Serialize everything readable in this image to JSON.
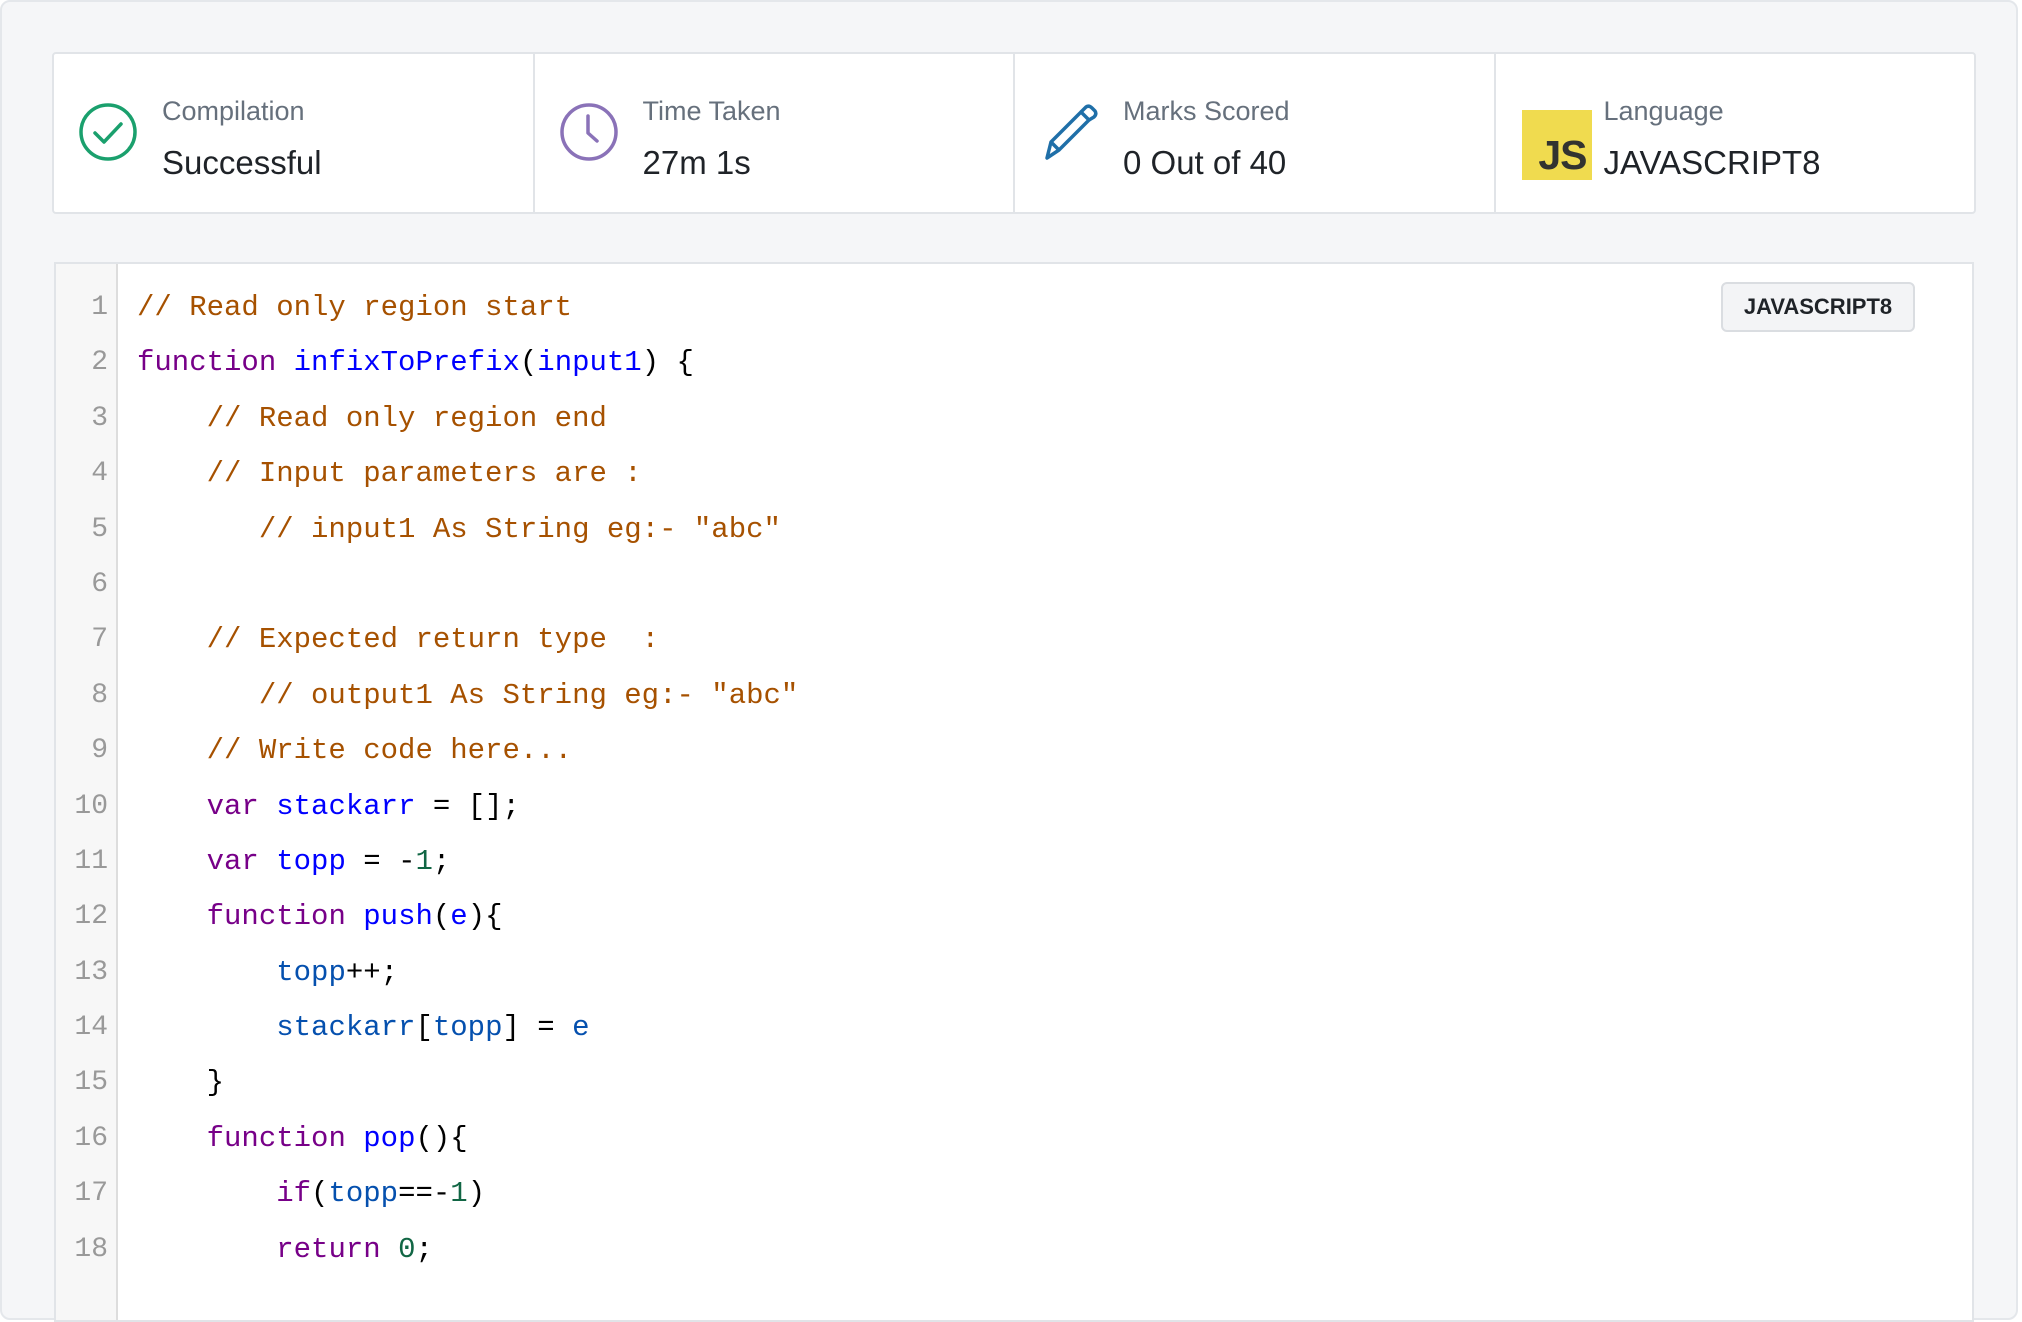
{
  "stats": [
    {
      "label": "Compilation",
      "value": "Successful",
      "icon": "check-circle-icon",
      "color": "#1aa06d"
    },
    {
      "label": "Time Taken",
      "value": "27m 1s",
      "icon": "clock-icon",
      "color": "#8a72b8"
    },
    {
      "label": "Marks Scored",
      "value": "0 Out of 40",
      "icon": "pencil-icon",
      "color": "#1f6fa8"
    },
    {
      "label": "Language",
      "value": "JAVASCRIPT8",
      "icon": "js-logo-icon",
      "logo_text": "JS",
      "color": "#f0db4f"
    }
  ],
  "editor": {
    "language_badge": "JAVASCRIPT8",
    "lines": [
      {
        "n": "1",
        "tokens": [
          {
            "t": "// Read only region start",
            "c": "comment"
          }
        ]
      },
      {
        "n": "2",
        "tokens": [
          {
            "t": "function ",
            "c": "keyword"
          },
          {
            "t": "infixToPrefix",
            "c": "def"
          },
          {
            "t": "(",
            "c": "plain"
          },
          {
            "t": "input1",
            "c": "def"
          },
          {
            "t": ") {",
            "c": "plain"
          }
        ]
      },
      {
        "n": "3",
        "tokens": [
          {
            "t": "    // Read only region end",
            "c": "comment"
          }
        ]
      },
      {
        "n": "4",
        "tokens": [
          {
            "t": "    // Input parameters are :",
            "c": "comment"
          }
        ]
      },
      {
        "n": "5",
        "tokens": [
          {
            "t": "       // input1 As String eg:- \"abc\"",
            "c": "comment"
          }
        ]
      },
      {
        "n": "6",
        "tokens": []
      },
      {
        "n": "7",
        "tokens": [
          {
            "t": "    // Expected return type  :",
            "c": "comment"
          }
        ]
      },
      {
        "n": "8",
        "tokens": [
          {
            "t": "       // output1 As String eg:- \"abc\"",
            "c": "comment"
          }
        ]
      },
      {
        "n": "9",
        "tokens": [
          {
            "t": "    // Write code here...",
            "c": "comment"
          }
        ]
      },
      {
        "n": "10",
        "tokens": [
          {
            "t": "    ",
            "c": "plain"
          },
          {
            "t": "var ",
            "c": "keyword"
          },
          {
            "t": "stackarr",
            "c": "def"
          },
          {
            "t": " = [];",
            "c": "plain"
          }
        ]
      },
      {
        "n": "11",
        "tokens": [
          {
            "t": "    ",
            "c": "plain"
          },
          {
            "t": "var ",
            "c": "keyword"
          },
          {
            "t": "topp",
            "c": "def"
          },
          {
            "t": " = -",
            "c": "plain"
          },
          {
            "t": "1",
            "c": "number"
          },
          {
            "t": ";",
            "c": "plain"
          }
        ]
      },
      {
        "n": "12",
        "tokens": [
          {
            "t": "    ",
            "c": "plain"
          },
          {
            "t": "function ",
            "c": "keyword"
          },
          {
            "t": "push",
            "c": "def"
          },
          {
            "t": "(",
            "c": "plain"
          },
          {
            "t": "e",
            "c": "def"
          },
          {
            "t": "){",
            "c": "plain"
          }
        ]
      },
      {
        "n": "13",
        "tokens": [
          {
            "t": "        ",
            "c": "plain"
          },
          {
            "t": "topp",
            "c": "variable"
          },
          {
            "t": "++;",
            "c": "plain"
          }
        ]
      },
      {
        "n": "14",
        "tokens": [
          {
            "t": "        ",
            "c": "plain"
          },
          {
            "t": "stackarr",
            "c": "variable"
          },
          {
            "t": "[",
            "c": "plain"
          },
          {
            "t": "topp",
            "c": "variable"
          },
          {
            "t": "] = ",
            "c": "plain"
          },
          {
            "t": "e",
            "c": "variable"
          }
        ]
      },
      {
        "n": "15",
        "tokens": [
          {
            "t": "    }",
            "c": "plain"
          }
        ]
      },
      {
        "n": "16",
        "tokens": [
          {
            "t": "    ",
            "c": "plain"
          },
          {
            "t": "function ",
            "c": "keyword"
          },
          {
            "t": "pop",
            "c": "def"
          },
          {
            "t": "(){",
            "c": "plain"
          }
        ]
      },
      {
        "n": "17",
        "tokens": [
          {
            "t": "        ",
            "c": "plain"
          },
          {
            "t": "if",
            "c": "keyword"
          },
          {
            "t": "(",
            "c": "plain"
          },
          {
            "t": "topp",
            "c": "variable"
          },
          {
            "t": "==-",
            "c": "plain"
          },
          {
            "t": "1",
            "c": "number"
          },
          {
            "t": ")",
            "c": "plain"
          }
        ]
      },
      {
        "n": "18",
        "tokens": [
          {
            "t": "        ",
            "c": "plain"
          },
          {
            "t": "return ",
            "c": "keyword"
          },
          {
            "t": "0",
            "c": "number"
          },
          {
            "t": ";",
            "c": "plain"
          }
        ]
      }
    ]
  }
}
